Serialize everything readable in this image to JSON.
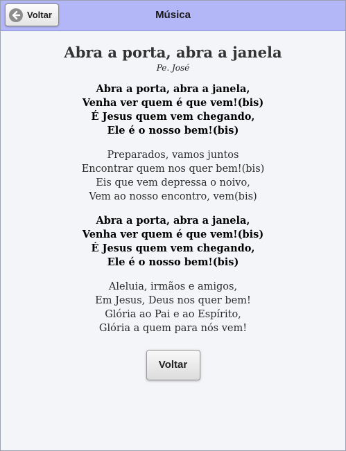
{
  "header": {
    "title": "Música",
    "back_label": "Voltar",
    "back_icon": "arrow-left-circle-icon",
    "background_color": "#b3b6f7"
  },
  "song": {
    "title": "Abra a porta, abra a janela",
    "author": "Pe. José",
    "stanzas": [
      {
        "type": "chorus",
        "lines": [
          "Abra a porta, abra a janela,",
          "Venha ver quem é que vem!(bis)",
          "É Jesus quem vem chegando,",
          "Ele é o nosso bem!(bis)"
        ]
      },
      {
        "type": "verse",
        "lines": [
          "Preparados, vamos juntos",
          "Encontrar quem nos quer bem!(bis)",
          "Eis que vem depressa o noivo,",
          "Vem ao nosso encontro, vem(bis)"
        ]
      },
      {
        "type": "chorus",
        "lines": [
          "Abra a porta, abra a janela,",
          "Venha ver quem é que vem!(bis)",
          "É Jesus quem vem chegando,",
          "Ele é o nosso bem!(bis)"
        ]
      },
      {
        "type": "verse",
        "lines": [
          "Aleluia, irmãos e amigos,",
          "Em Jesus, Deus nos quer bem!",
          "Glória ao Pai e ao Espírito,",
          "Glória a quem para nós vem!"
        ]
      }
    ]
  },
  "footer": {
    "back_label": "Voltar"
  }
}
